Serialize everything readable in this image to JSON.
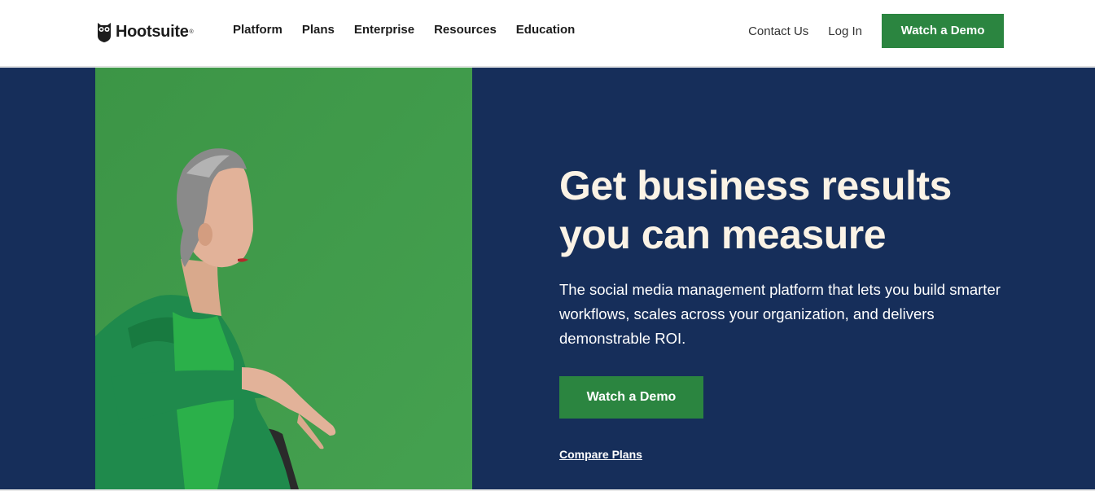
{
  "brand": {
    "name": "Hootsuite",
    "registered_mark": "®",
    "logo_icon": "owl-icon"
  },
  "nav": {
    "items": [
      {
        "label": "Platform"
      },
      {
        "label": "Plans"
      },
      {
        "label": "Enterprise"
      },
      {
        "label": "Resources"
      },
      {
        "label": "Education"
      }
    ]
  },
  "utility": {
    "contact_label": "Contact Us",
    "login_label": "Log In",
    "demo_label": "Watch a Demo"
  },
  "hero": {
    "headline_line1": "Get business results",
    "headline_line2": "you can measure",
    "description": "The social media management platform that lets you build smarter workflows, scales across your organization, and delivers demonstrable ROI.",
    "cta_label": "Watch a Demo",
    "secondary_link": "Compare Plans"
  },
  "colors": {
    "accent_green": "#2b8540",
    "hero_navy": "#162e5a",
    "headline_cream": "#fbf3e6",
    "photo_green": "#3f9a49"
  }
}
